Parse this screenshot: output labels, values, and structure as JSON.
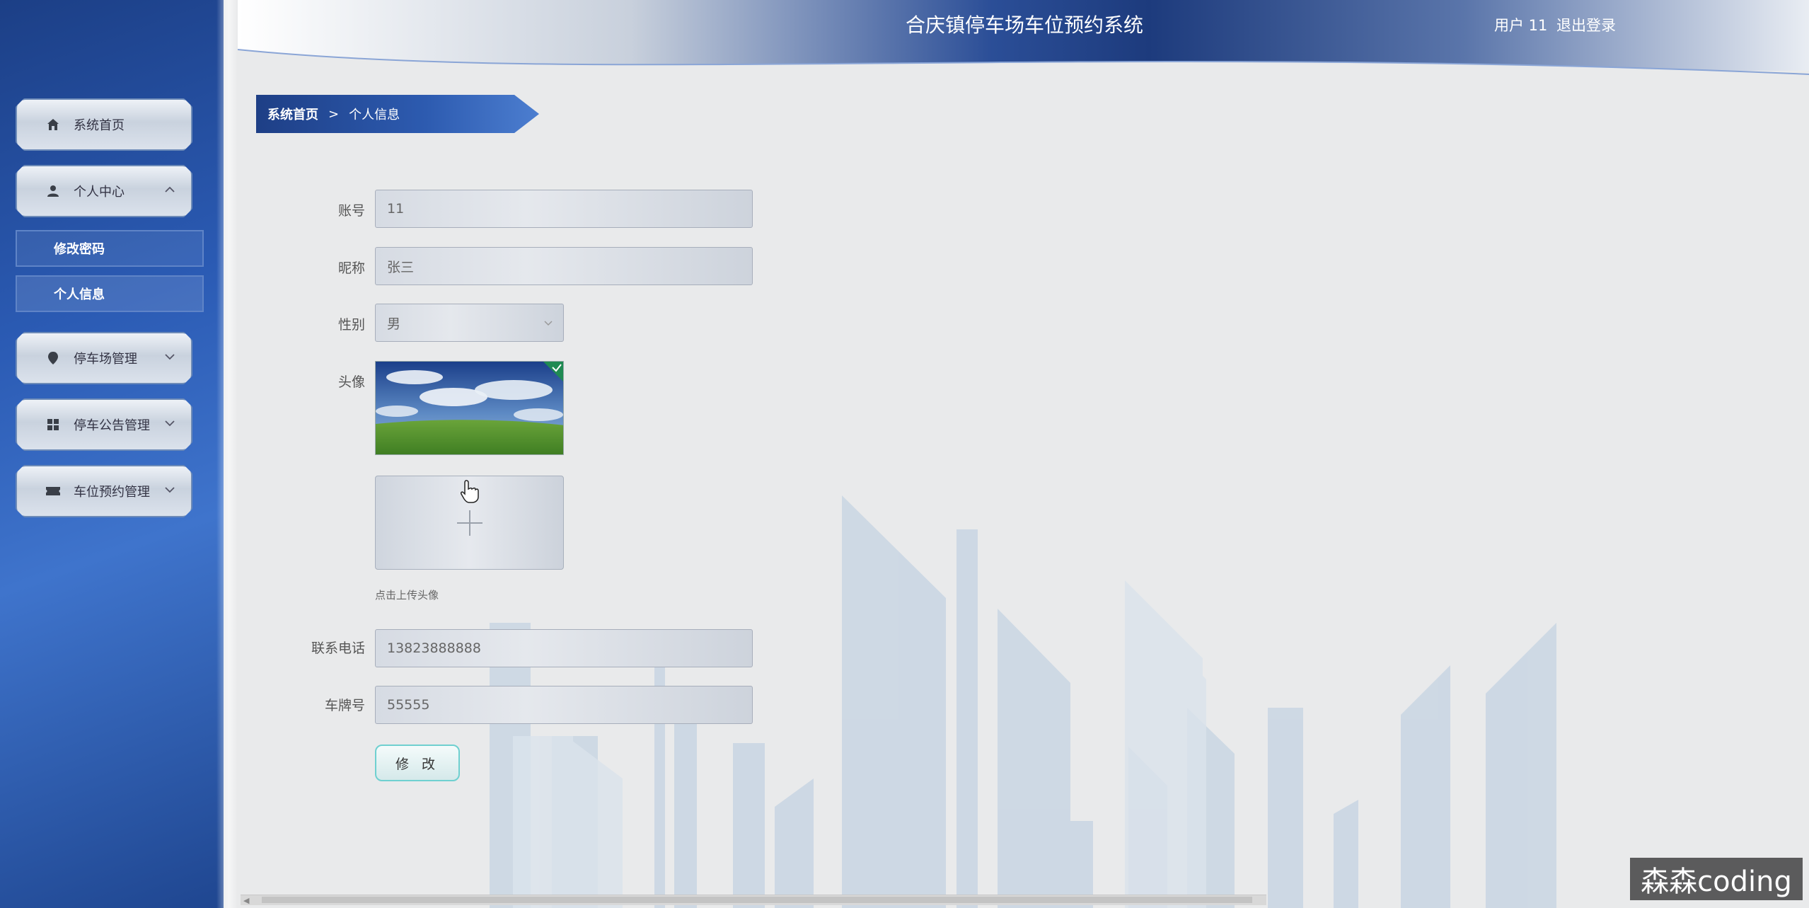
{
  "header": {
    "title": "合庆镇停车场车位预约系统",
    "user": "用户 11",
    "logout": "退出登录"
  },
  "sidebar": {
    "items": [
      {
        "label": "系统首页",
        "icon": "home-icon"
      },
      {
        "label": "个人中心",
        "icon": "user-icon",
        "expanded": true,
        "children": [
          {
            "label": "修改密码"
          },
          {
            "label": "个人信息"
          }
        ]
      },
      {
        "label": "停车场管理",
        "icon": "location-icon"
      },
      {
        "label": "停车公告管理",
        "icon": "grid-icon"
      },
      {
        "label": "车位预约管理",
        "icon": "ticket-icon"
      }
    ]
  },
  "breadcrumb": {
    "home": "系统首页",
    "separator": ">",
    "current": "个人信息"
  },
  "form": {
    "account_label": "账号",
    "account_value": "11",
    "nickname_label": "昵称",
    "nickname_value": "张三",
    "gender_label": "性别",
    "gender_value": "男",
    "avatar_label": "头像",
    "upload_tip": "点击上传头像",
    "phone_label": "联系电话",
    "phone_value": "13823888888",
    "plate_label": "车牌号",
    "plate_value": "55555",
    "submit_label": "修 改"
  },
  "watermark": "森森coding",
  "colors": {
    "sidebar_blue": "#2b5bb4",
    "header_blue": "#1d3b7d",
    "button_border": "#6fd0d0"
  }
}
